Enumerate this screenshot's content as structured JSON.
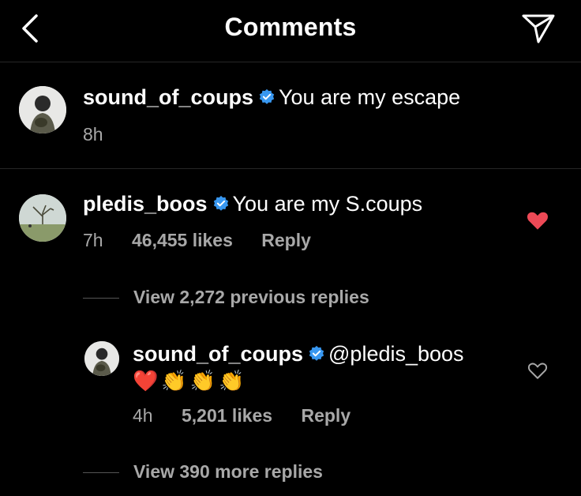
{
  "header": {
    "title": "Comments"
  },
  "caption": {
    "username": "sound_of_coups",
    "text": "You are my escape",
    "time": "8h"
  },
  "comment": {
    "username": "pledis_boos",
    "text": "You are my S.coups",
    "time": "7h",
    "likes": "46,455 likes",
    "reply": "Reply",
    "liked": true,
    "view_replies": "View 2,272 previous replies"
  },
  "reply": {
    "username": "sound_of_coups",
    "mention": "@pledis_boos",
    "emojis": [
      "❤️",
      "👏",
      "👏",
      "👏"
    ],
    "time": "4h",
    "likes": "5,201 likes",
    "reply": "Reply",
    "liked": false,
    "view_more": "View 390 more replies"
  },
  "colors": {
    "like_red": "#ed4956",
    "verified_blue": "#3897f0",
    "secondary_text": "#a8a8a8"
  }
}
